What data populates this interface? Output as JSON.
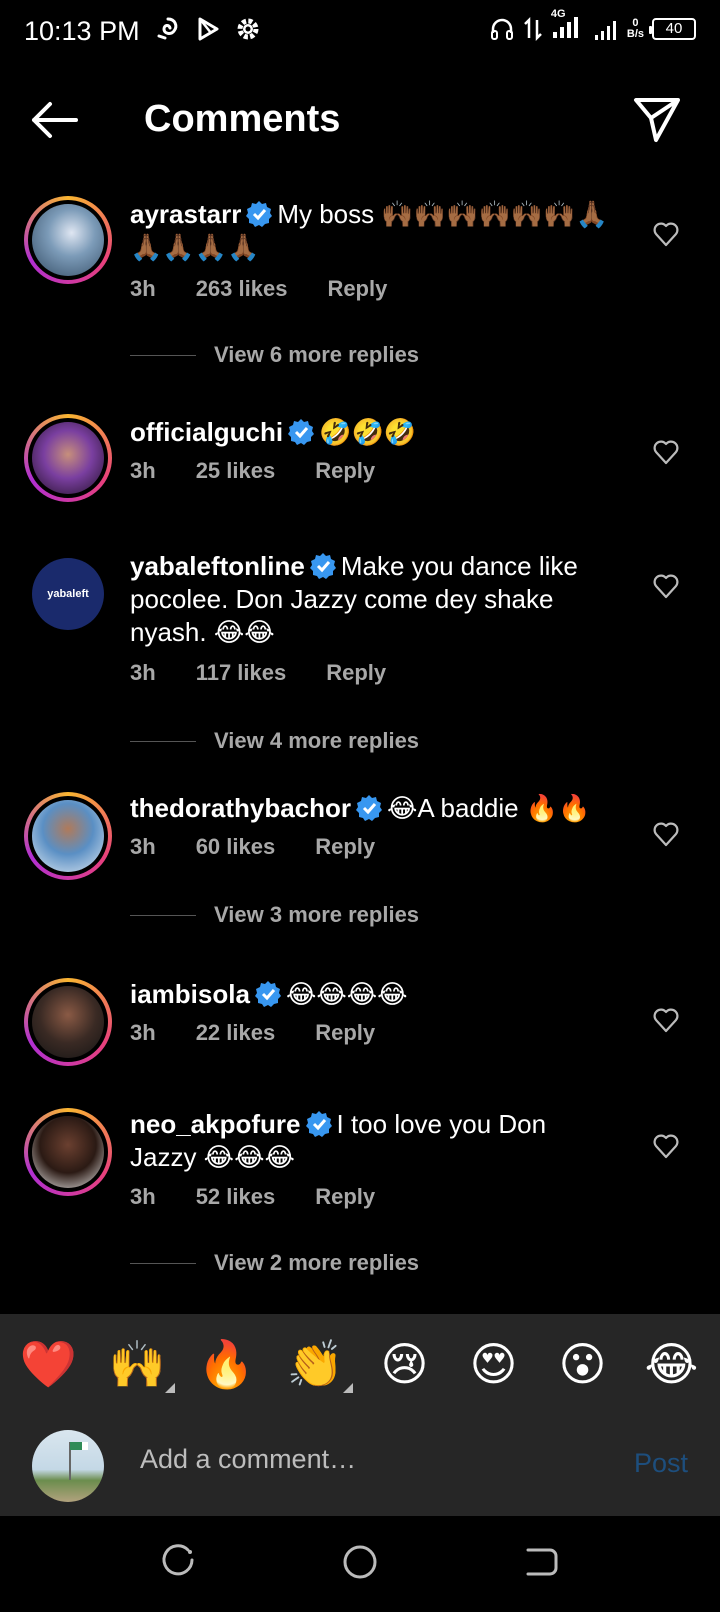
{
  "status_bar": {
    "time": "10:13 PM",
    "network": "4G",
    "speed_value": "0",
    "speed_unit": "B/s",
    "battery": "40"
  },
  "header": {
    "title": "Comments",
    "back_icon": "arrow-left-icon",
    "share_icon": "send-icon"
  },
  "comments": [
    {
      "username": "ayrastarr",
      "text": "My boss 🙌🏾🙌🏾🙌🏾🙌🏾🙌🏾🙌🏾🙏🏾🙏🏾🙏🏾🙏🏾🙏🏾",
      "time": "3h",
      "likes": "263 likes",
      "reply": "Reply",
      "view_replies": "View 6 more replies"
    },
    {
      "username": "officialguchi",
      "text": "🤣🤣🤣",
      "time": "3h",
      "likes": "25 likes",
      "reply": "Reply"
    },
    {
      "username": "yabaleftonline",
      "text": "Make you dance like pocolee. Don Jazzy come dey shake nyash. 😂😂",
      "time": "3h",
      "likes": "117 likes",
      "reply": "Reply",
      "view_replies": "View 4 more replies",
      "avatar_text": "yabaleft"
    },
    {
      "username": "thedorathybachor",
      "text": "😂A baddie 🔥🔥",
      "time": "3h",
      "likes": "60 likes",
      "reply": "Reply",
      "view_replies": "View 3 more replies"
    },
    {
      "username": "iambisola",
      "text": "😂😂😂😂",
      "time": "3h",
      "likes": "22 likes",
      "reply": "Reply"
    },
    {
      "username": "neo_akpofure",
      "text": "I too love you Don Jazzy 😂😂😂",
      "time": "3h",
      "likes": "52 likes",
      "reply": "Reply",
      "view_replies": "View 2 more replies"
    }
  ],
  "emoji_bar": [
    "❤️",
    "🙌",
    "🔥",
    "👏",
    "😢",
    "😍",
    "😮",
    "😂"
  ],
  "input": {
    "placeholder": "Add a comment…",
    "post": "Post"
  },
  "colors": {
    "background": "#000000",
    "secondary_text": "#a8a8a8",
    "verified": "#3897f0",
    "post_disabled": "#1d4e7d",
    "bar_bg": "#262626"
  }
}
